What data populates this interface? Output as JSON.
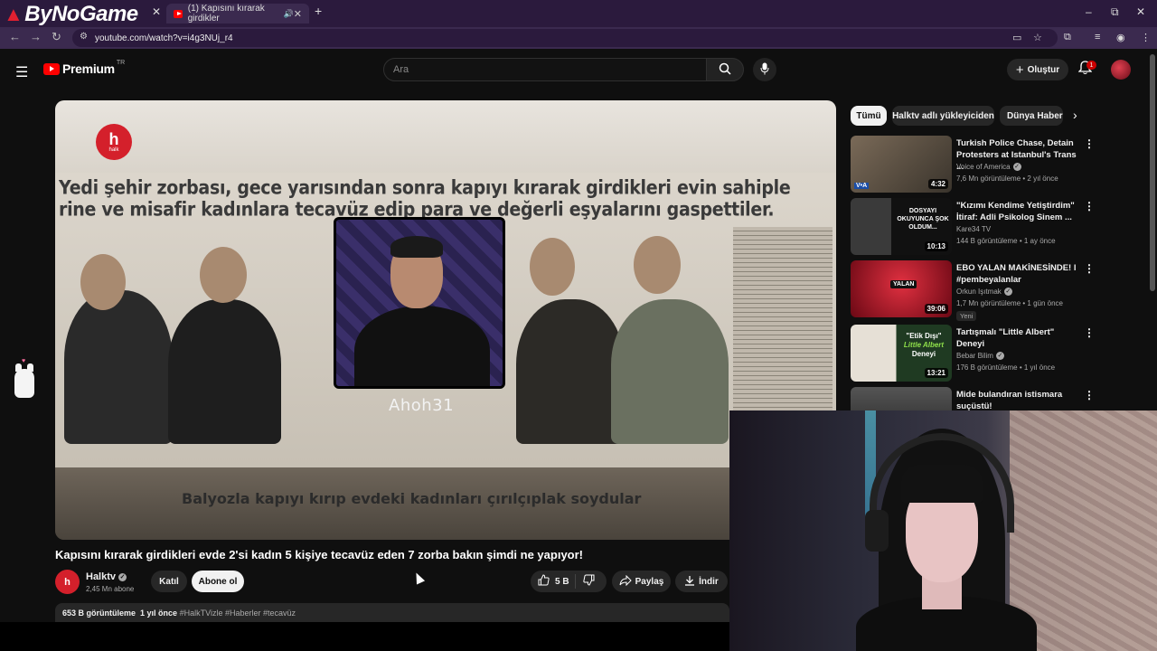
{
  "browser": {
    "brand": "ByNoGame",
    "tab_title": "(1) Kapısını kırarak girdikler",
    "new_tab": "+",
    "url": "youtube.com/watch?v=i4g3NUj_r4",
    "window_controls": [
      "–",
      "⧉",
      "✕"
    ]
  },
  "youtube": {
    "logo_text": "Premium",
    "region": "TR",
    "search_placeholder": "Ara",
    "create_label": "Oluştur",
    "notification_count": "1"
  },
  "video": {
    "newspaper_line1": "Yedi şehir zorbası, gece yarısından sonra kapıyı kırarak girdikleri evin sahiple",
    "newspaper_line2": "rine ve misafir kadınlara  tecavüz edip para ve değerli eşyalarını gaspettiler.",
    "newspaper_caption": "Balyozla kapıyı kırıp evdeki kadınları çırılçıplak soydular",
    "channel_logo": "h",
    "channel_logo_sub": "halk",
    "watermark": "Ahoh31",
    "title": "Kapısını kırarak girdikleri evde 2'si kadın 5 kişiye tecavüz eden 7 zorba bakın şimdi ne yapıyor!",
    "channel": "Halktv",
    "subscribers": "2,45 Mn abone",
    "join_label": "Katıl",
    "subscribe_label": "Abone ol",
    "likes": "5 B",
    "share_label": "Paylaş",
    "download_label": "İndir",
    "views": "653 B görüntüleme",
    "age": "1 yıl önce",
    "hashtags": "#HalkTVizle #Haberler #tecavüz"
  },
  "chips": [
    "Tümü",
    "Halktv adlı yükleyiciden",
    "Dünya Haberleri"
  ],
  "related": [
    {
      "title": "Turkish Police Chase, Detain Protesters at Istanbul's Trans ...",
      "channel": "Voice of America",
      "verified": true,
      "meta": "7,6 Mn görüntüleme • 2 yıl önce",
      "duration": "4:32",
      "badge": "",
      "thumb_colors": [
        "#6a5a48",
        "#2f2a25"
      ]
    },
    {
      "title": "\"Kızımı Kendime Yetiştirdim\" İtiraf: Adli Psikolog Sinem ...",
      "channel": "Kare34 TV",
      "verified": false,
      "meta": "144 B görüntüleme • 1 ay önce",
      "duration": "10:13",
      "badge": "",
      "thumb_colors": [
        "#1a1a1a",
        "#555"
      ]
    },
    {
      "title": "EBO YALAN MAKİNESİNDE! l #pembeyalanlar",
      "channel": "Orkun Işıtmak",
      "verified": true,
      "meta": "1,7 Mn görüntüleme • 1 gün önce",
      "duration": "39:06",
      "badge": "Yeni",
      "thumb_colors": [
        "#8a1020",
        "#d03040"
      ]
    },
    {
      "title": "Tartışmalı \"Little Albert\" Deneyi",
      "channel": "Bebar Bilim",
      "verified": true,
      "meta": "176 B görüntüleme • 1 yıl önce",
      "duration": "13:21",
      "badge": "",
      "thumb_colors": [
        "#e8e4dc",
        "#3a6a3a"
      ]
    },
    {
      "title": "Mide bulandıran istismara suçüstü!",
      "channel": "",
      "verified": false,
      "meta": "",
      "duration": "",
      "badge": "",
      "thumb_colors": [
        "#444",
        "#222"
      ]
    }
  ],
  "icons": {
    "menu": "☰",
    "search": "⌕",
    "mic": "🎙",
    "bell": "🔔",
    "chevron": "›",
    "kebab": "⋮",
    "like": "👍",
    "dislike": "👎",
    "share": "↪",
    "download": "⤓",
    "check": "✓"
  }
}
